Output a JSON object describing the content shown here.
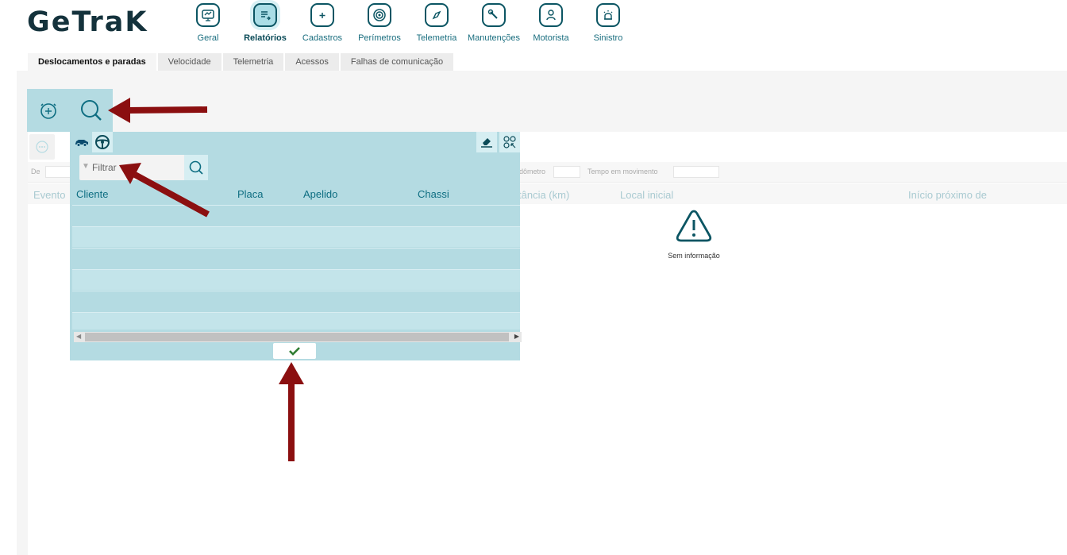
{
  "brand": {
    "logo_text": "GeTraK"
  },
  "nav": {
    "items": [
      {
        "label": "Geral",
        "icon": "monitor-chart-icon",
        "active": false
      },
      {
        "label": "Relatórios",
        "icon": "report-icon",
        "active": true
      },
      {
        "label": "Cadastros",
        "icon": "folder-plus-icon",
        "active": false
      },
      {
        "label": "Perímetros",
        "icon": "target-icon",
        "active": false
      },
      {
        "label": "Telemetria",
        "icon": "compass-icon",
        "active": false
      },
      {
        "label": "Manutenções",
        "icon": "wrench-icon",
        "active": false
      },
      {
        "label": "Motorista",
        "icon": "driver-icon",
        "active": false
      },
      {
        "label": "Sinistro",
        "icon": "siren-icon",
        "active": false
      }
    ]
  },
  "tabs": [
    {
      "label": "Deslocamentos e paradas",
      "active": true
    },
    {
      "label": "Velocidade",
      "active": false
    },
    {
      "label": "Telemetria",
      "active": false
    },
    {
      "label": "Acessos",
      "active": false
    },
    {
      "label": "Falhas de comunicação",
      "active": false
    }
  ],
  "filters": {
    "from_label": "De",
    "odometer_label": "dômetro",
    "moving_time_label": "Tempo em movimento"
  },
  "report_table": {
    "headers": [
      "Evento",
      "tância (km)",
      "Local inicial",
      "Início próximo de"
    ],
    "empty_message": "Sem informação"
  },
  "vehicle_selector": {
    "search": {
      "placeholder": "Filtrar",
      "value": ""
    },
    "headers": [
      "Cliente",
      "Placa",
      "Apelido",
      "Chassi"
    ],
    "rows": []
  },
  "colors": {
    "accent": "#b4dbe2",
    "accent_dark": "#0b5563",
    "arrow": "#8b0f10",
    "confirm": "#2f7d32"
  }
}
